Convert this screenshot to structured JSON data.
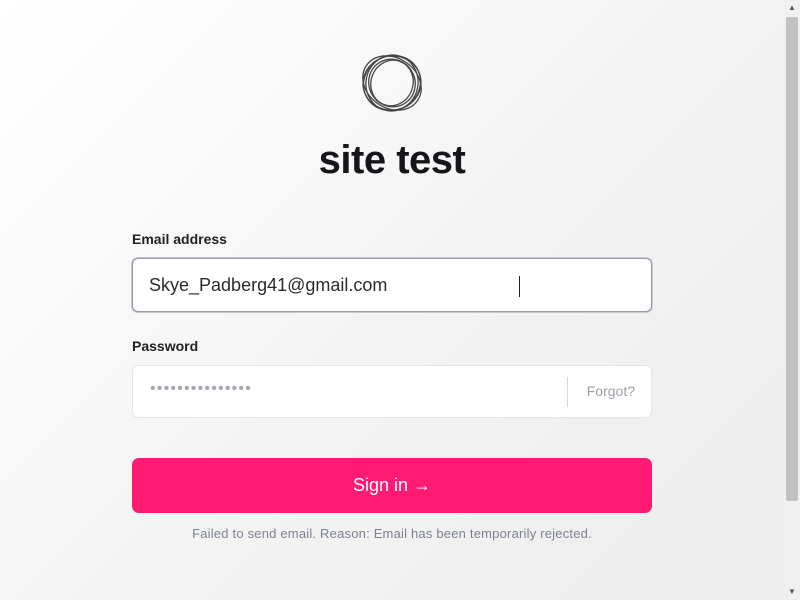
{
  "app": {
    "title": "site test",
    "logo": "ring-logo-icon"
  },
  "form": {
    "email_label": "Email address",
    "email_value": "Skye_Padberg41@gmail.com",
    "password_label": "Password",
    "password_mask": "•••••••••••••••",
    "forgot_label": "Forgot?",
    "signin_label": "Sign in →",
    "error_message": "Failed to send email. Reason: Email has been temporarily rejected."
  },
  "colors": {
    "accent": "#ff1a74",
    "error_text": "#7d8293"
  },
  "icons": {
    "scroll_up": "scroll-up-arrow-icon",
    "scroll_down": "scroll-down-arrow-icon"
  }
}
